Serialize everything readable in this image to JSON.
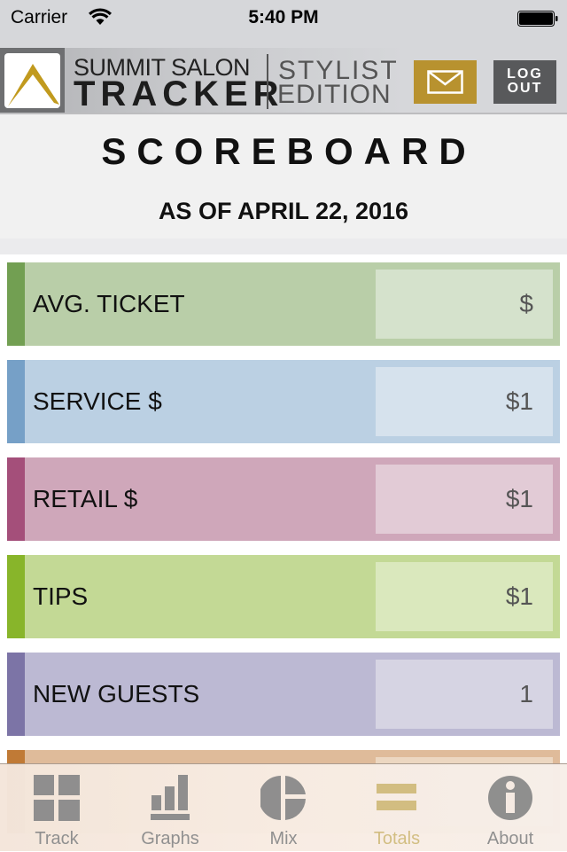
{
  "status_bar": {
    "carrier": "Carrier",
    "time": "5:40 PM",
    "wifi_icon": "wifi-icon",
    "battery_icon": "battery-full-icon"
  },
  "banner": {
    "brand_line1": "SUMMIT SALON",
    "brand_line2": "TRACKER",
    "edition_line1": "STYLIST",
    "edition_line2": "EDITION",
    "logo_icon": "summit-peak-logo",
    "mail_icon": "envelope-icon",
    "logout_line1": "LOG",
    "logout_line2": "OUT",
    "colors": {
      "gold": "#b8922f",
      "dark": "#58595b"
    }
  },
  "header": {
    "title": "SCOREBOARD",
    "date": "AS OF APRIL 22, 2016"
  },
  "scoreboard": {
    "rows": [
      {
        "label": "AVG. TICKET",
        "value": "$",
        "accent": "#729f52",
        "bg": "#b9cea8",
        "box": "#d5e2cc"
      },
      {
        "label": "SERVICE $",
        "value": "$1",
        "accent": "#76a0c7",
        "bg": "#bbd0e3",
        "box": "#d6e2ed"
      },
      {
        "label": "RETAIL $",
        "value": "$1",
        "accent": "#a44f7a",
        "bg": "#cfa7ba",
        "box": "#e2cbd6"
      },
      {
        "label": "TIPS",
        "value": "$1",
        "accent": "#88b52a",
        "bg": "#c3d995",
        "box": "#dae8bd"
      },
      {
        "label": "NEW GUESTS",
        "value": "1",
        "accent": "#7c74a6",
        "bg": "#bcb9d3",
        "box": "#d6d4e3"
      },
      {
        "label": "",
        "value": "",
        "accent": "#c07a36",
        "bg": "#dfbb9a",
        "box": "#ecd7c1"
      }
    ]
  },
  "tabbar": {
    "active_color": "#d2bd80",
    "inactive_color": "#8e8e8e",
    "tabs": [
      {
        "label": "Track",
        "icon": "grid-icon",
        "active": false
      },
      {
        "label": "Graphs",
        "icon": "bar-chart-icon",
        "active": false
      },
      {
        "label": "Mix",
        "icon": "pie-chart-icon",
        "active": false
      },
      {
        "label": "Totals",
        "icon": "equals-icon",
        "active": true
      },
      {
        "label": "About",
        "icon": "info-icon",
        "active": false
      }
    ]
  }
}
